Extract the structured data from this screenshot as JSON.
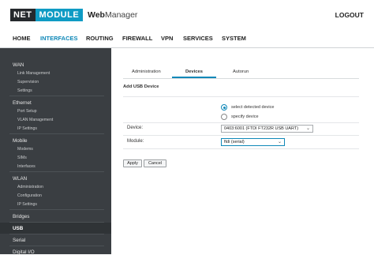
{
  "brand": {
    "net": "NET",
    "module": "MODULE",
    "app_bold": "Web",
    "app_rest": "Manager"
  },
  "header": {
    "logout": "LOGOUT"
  },
  "mainnav": [
    "HOME",
    "INTERFACES",
    "ROUTING",
    "FIREWALL",
    "VPN",
    "SERVICES",
    "SYSTEM"
  ],
  "mainnav_active": "INTERFACES",
  "sidebar": {
    "wan": {
      "label": "WAN",
      "items": [
        "Link Management",
        "Supervision",
        "Settings"
      ]
    },
    "ethernet": {
      "label": "Ethernet",
      "items": [
        "Port Setup",
        "VLAN Management",
        "IP Settings"
      ]
    },
    "mobile": {
      "label": "Mobile",
      "items": [
        "Modems",
        "SIMs",
        "Interfaces"
      ]
    },
    "wlan": {
      "label": "WLAN",
      "items": [
        "Administration",
        "Configuration",
        "IP Settings"
      ]
    },
    "bridges": "Bridges",
    "usb": "USB",
    "serial": "Serial",
    "digital": "Digital I/O"
  },
  "tabs": [
    "Administration",
    "Devices",
    "Autorun"
  ],
  "active_tab": "Devices",
  "section": {
    "title": "Add USB Device"
  },
  "radios": [
    {
      "label": "select detected device",
      "checked": true
    },
    {
      "label": "specify device",
      "checked": false
    }
  ],
  "form": {
    "device_label": "Device:",
    "device_value": "0403:6001 (FTDI FT232R USB UART)",
    "module_label": "Module:",
    "module_value": "ftdi (serial)"
  },
  "buttons": {
    "apply": "Apply",
    "cancel": "Cancel"
  },
  "colors": {
    "accent": "#0f88b8",
    "sidebar_bg": "#3a3e42",
    "logo_dark": "#25292d",
    "logo_blue": "#0f9bc4"
  }
}
